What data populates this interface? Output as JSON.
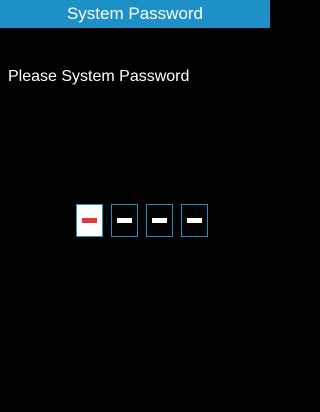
{
  "header": {
    "title": "System Password"
  },
  "prompt": {
    "text": "Please System Password"
  },
  "password": {
    "length": 4,
    "active_index": 0,
    "entered": 0
  },
  "colors": {
    "accent": "#1e90c8",
    "background": "#000000",
    "text": "#ffffff",
    "cursor": "#e03a3a"
  }
}
